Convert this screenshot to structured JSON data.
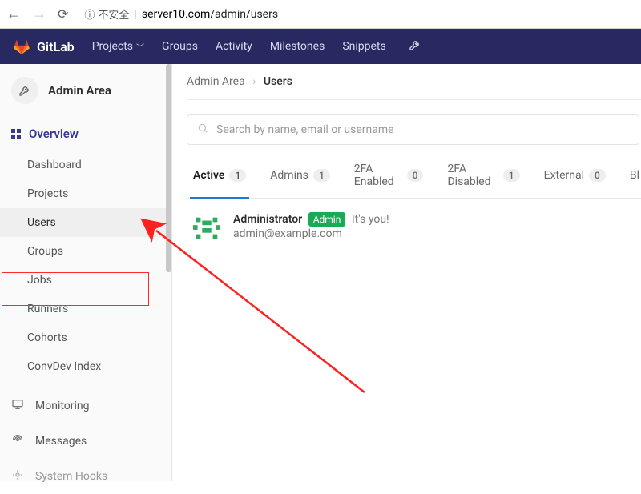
{
  "browser": {
    "insecure_label": "不安全",
    "url_prefix": "server10.com",
    "url_path": "/admin/users"
  },
  "topnav": {
    "brand": "GitLab",
    "items": [
      {
        "label": "Projects",
        "dropdown": true
      },
      {
        "label": "Groups"
      },
      {
        "label": "Activity"
      },
      {
        "label": "Milestones"
      },
      {
        "label": "Snippets"
      }
    ]
  },
  "sidebar": {
    "title": "Admin Area",
    "section": "Overview",
    "items": [
      {
        "label": "Dashboard"
      },
      {
        "label": "Projects"
      },
      {
        "label": "Users",
        "active": true
      },
      {
        "label": "Groups"
      },
      {
        "label": "Jobs"
      },
      {
        "label": "Runners"
      },
      {
        "label": "Cohorts"
      },
      {
        "label": "ConvDev Index"
      }
    ],
    "bottom": [
      {
        "label": "Monitoring",
        "icon": "monitor"
      },
      {
        "label": "Messages",
        "icon": "broadcast"
      },
      {
        "label": "System Hooks",
        "icon": "hook"
      }
    ]
  },
  "breadcrumb": {
    "root": "Admin Area",
    "current": "Users"
  },
  "search": {
    "placeholder": "Search by name, email or username"
  },
  "tabs": [
    {
      "label": "Active",
      "count": "1",
      "active": true
    },
    {
      "label": "Admins",
      "count": "1"
    },
    {
      "label": "2FA Enabled",
      "count": "0"
    },
    {
      "label": "2FA Disabled",
      "count": "1"
    },
    {
      "label": "External",
      "count": "0"
    },
    {
      "label": "Bl",
      "count": ""
    }
  ],
  "user": {
    "name": "Administrator",
    "badge": "Admin",
    "note": "It's you!",
    "email": "admin@example.com"
  }
}
